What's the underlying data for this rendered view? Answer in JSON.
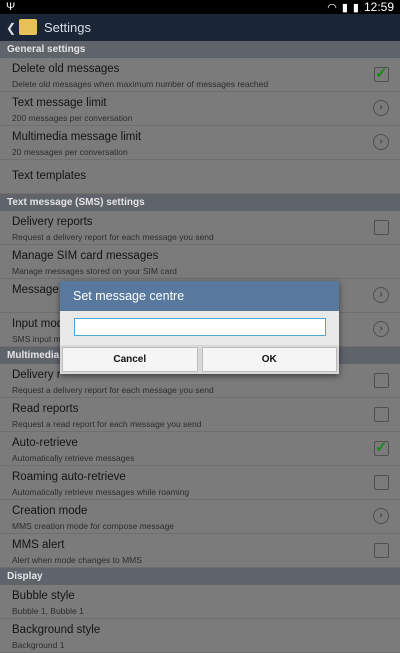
{
  "status": {
    "time": "12:59"
  },
  "header": {
    "title": "Settings"
  },
  "sections": {
    "general": "General settings",
    "sms": "Text message (SMS) settings",
    "mms": "Multimedia",
    "display": "Display"
  },
  "rows": {
    "delete_old": {
      "title": "Delete old messages",
      "sub": "Delete old messages when maximum number of messages reached",
      "checked": true
    },
    "text_limit": {
      "title": "Text message limit",
      "sub": "200 messages per conversation"
    },
    "mms_limit": {
      "title": "Multimedia message limit",
      "sub": "20 messages per conversation"
    },
    "templates": {
      "title": "Text templates"
    },
    "delivery_sms": {
      "title": "Delivery reports",
      "sub": "Request a delivery report for each message you send",
      "checked": false
    },
    "manage_sim": {
      "title": "Manage SIM card messages",
      "sub": "Manage messages stored on your SIM card"
    },
    "message_centre": {
      "title": "Message"
    },
    "input_mode": {
      "title": "Input mod",
      "sub": "SMS input m"
    },
    "delivery_mms": {
      "title": "Delivery r",
      "sub": "Request a delivery report for each message you send",
      "checked": false
    },
    "read_reports": {
      "title": "Read reports",
      "sub": "Request a read report for each message you send",
      "checked": false
    },
    "auto_retrieve": {
      "title": "Auto-retrieve",
      "sub": "Automatically retrieve messages",
      "checked": true
    },
    "roaming": {
      "title": "Roaming auto-retrieve",
      "sub": "Automatically retrieve messages while roaming",
      "checked": false
    },
    "creation": {
      "title": "Creation mode",
      "sub": "MMS creation mode for compose message"
    },
    "mms_alert": {
      "title": "MMS alert",
      "sub": "Alert when mode changes to MMS",
      "checked": false
    },
    "bubble": {
      "title": "Bubble style",
      "sub": "Bubble 1, Bubble 1"
    },
    "background": {
      "title": "Background style",
      "sub": "Background 1"
    }
  },
  "dialog": {
    "title": "Set message centre",
    "value": "",
    "cancel": "Cancel",
    "ok": "OK"
  }
}
